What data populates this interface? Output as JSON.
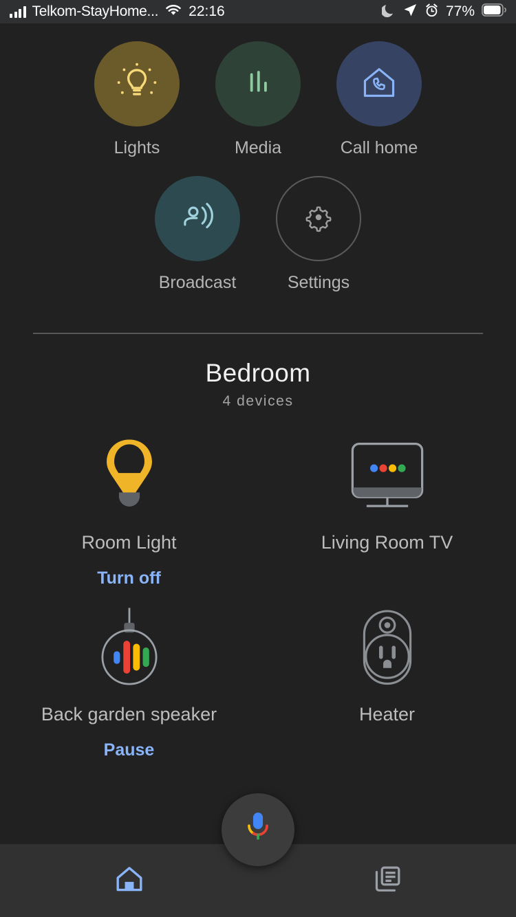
{
  "status_bar": {
    "carrier": "Telkom-StayHome...",
    "time": "22:16",
    "battery_percent": "77%",
    "icons": [
      "signal-bars-icon",
      "wifi-icon",
      "moon-dnd-icon",
      "location-arrow-icon",
      "alarm-clock-icon",
      "battery-icon"
    ]
  },
  "quick_actions": {
    "row1": [
      {
        "label": "Lights",
        "icon": "lightbulb-icon",
        "circle_color": "#6b5a2a",
        "icon_color": "#f8d978"
      },
      {
        "label": "Media",
        "icon": "equalizer-icon",
        "circle_color": "#2f4238",
        "icon_color": "#8fc9a1"
      },
      {
        "label": "Call home",
        "icon": "house-phone-icon",
        "circle_color": "#364363",
        "icon_color": "#8ab4f8"
      }
    ],
    "row2": [
      {
        "label": "Broadcast",
        "icon": "broadcast-icon",
        "circle_color": "#2d4a50",
        "icon_color": "#9fd2dc"
      },
      {
        "label": "Settings",
        "icon": "gear-icon",
        "circle_color": "transparent",
        "icon_color": "#9e9e9e"
      }
    ]
  },
  "room": {
    "title": "Bedroom",
    "device_count_label": "4 devices"
  },
  "devices": [
    {
      "name": "Room Light",
      "icon": "filled-lightbulb-icon",
      "action": "Turn off"
    },
    {
      "name": "Living Room TV",
      "icon": "tv-chromecast-icon",
      "action": ""
    },
    {
      "name": "Back garden speaker",
      "icon": "pendant-speaker-icon",
      "action": "Pause"
    },
    {
      "name": "Heater",
      "icon": "smart-plug-icon",
      "action": ""
    }
  ],
  "bottom_nav": {
    "items": [
      {
        "icon": "home-icon",
        "active": true
      },
      {
        "icon": "feed-icon",
        "active": false
      }
    ],
    "assistant_button": {
      "icon": "google-assistant-mic-icon"
    }
  },
  "colors": {
    "background": "#212121",
    "nav_background": "#313131",
    "accent_blue": "#8ab4f8",
    "google_blue": "#4285f4",
    "google_red": "#ea4335",
    "google_yellow": "#fbbc05",
    "google_green": "#34a853"
  }
}
